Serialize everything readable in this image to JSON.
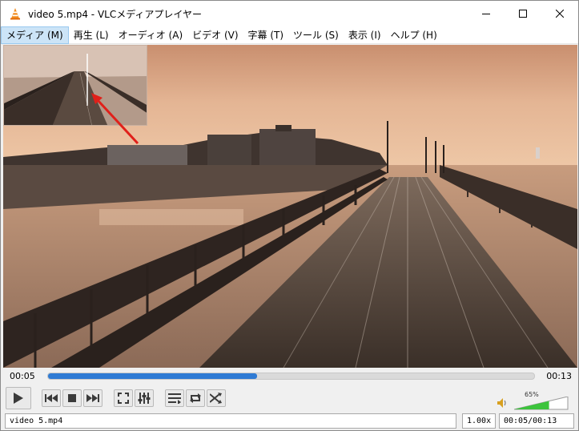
{
  "window": {
    "title": "video 5.mp4 - VLCメディアプレイヤー",
    "controls": [
      "minimize-icon",
      "maximize-icon",
      "close-icon"
    ]
  },
  "menu": {
    "items": [
      {
        "label": "メディア (M)",
        "active": true
      },
      {
        "label": "再生 (L)"
      },
      {
        "label": "オーディオ (A)"
      },
      {
        "label": "ビデオ (V)"
      },
      {
        "label": "字幕 (T)"
      },
      {
        "label": "ツール (S)"
      },
      {
        "label": "表示 (I)"
      },
      {
        "label": "ヘルプ (H)"
      }
    ]
  },
  "playback": {
    "elapsed": "00:05",
    "total": "00:13",
    "progress_fraction": 0.43
  },
  "controls": {
    "buttons": [
      "play-icon",
      "previous-icon",
      "stop-icon",
      "next-icon",
      "fullscreen-icon",
      "extended-settings-icon",
      "playlist-icon",
      "loop-icon",
      "shuffle-icon"
    ],
    "volume_label": "65%",
    "volume_fraction": 0.65
  },
  "status": {
    "filename": "video 5.mp4",
    "speed": "1.00x",
    "time": "00:05/00:13"
  },
  "colors": {
    "accent": "#2f7bd4",
    "volume_green": "#3cc43c",
    "menu_highlight": "#cce4f7"
  }
}
